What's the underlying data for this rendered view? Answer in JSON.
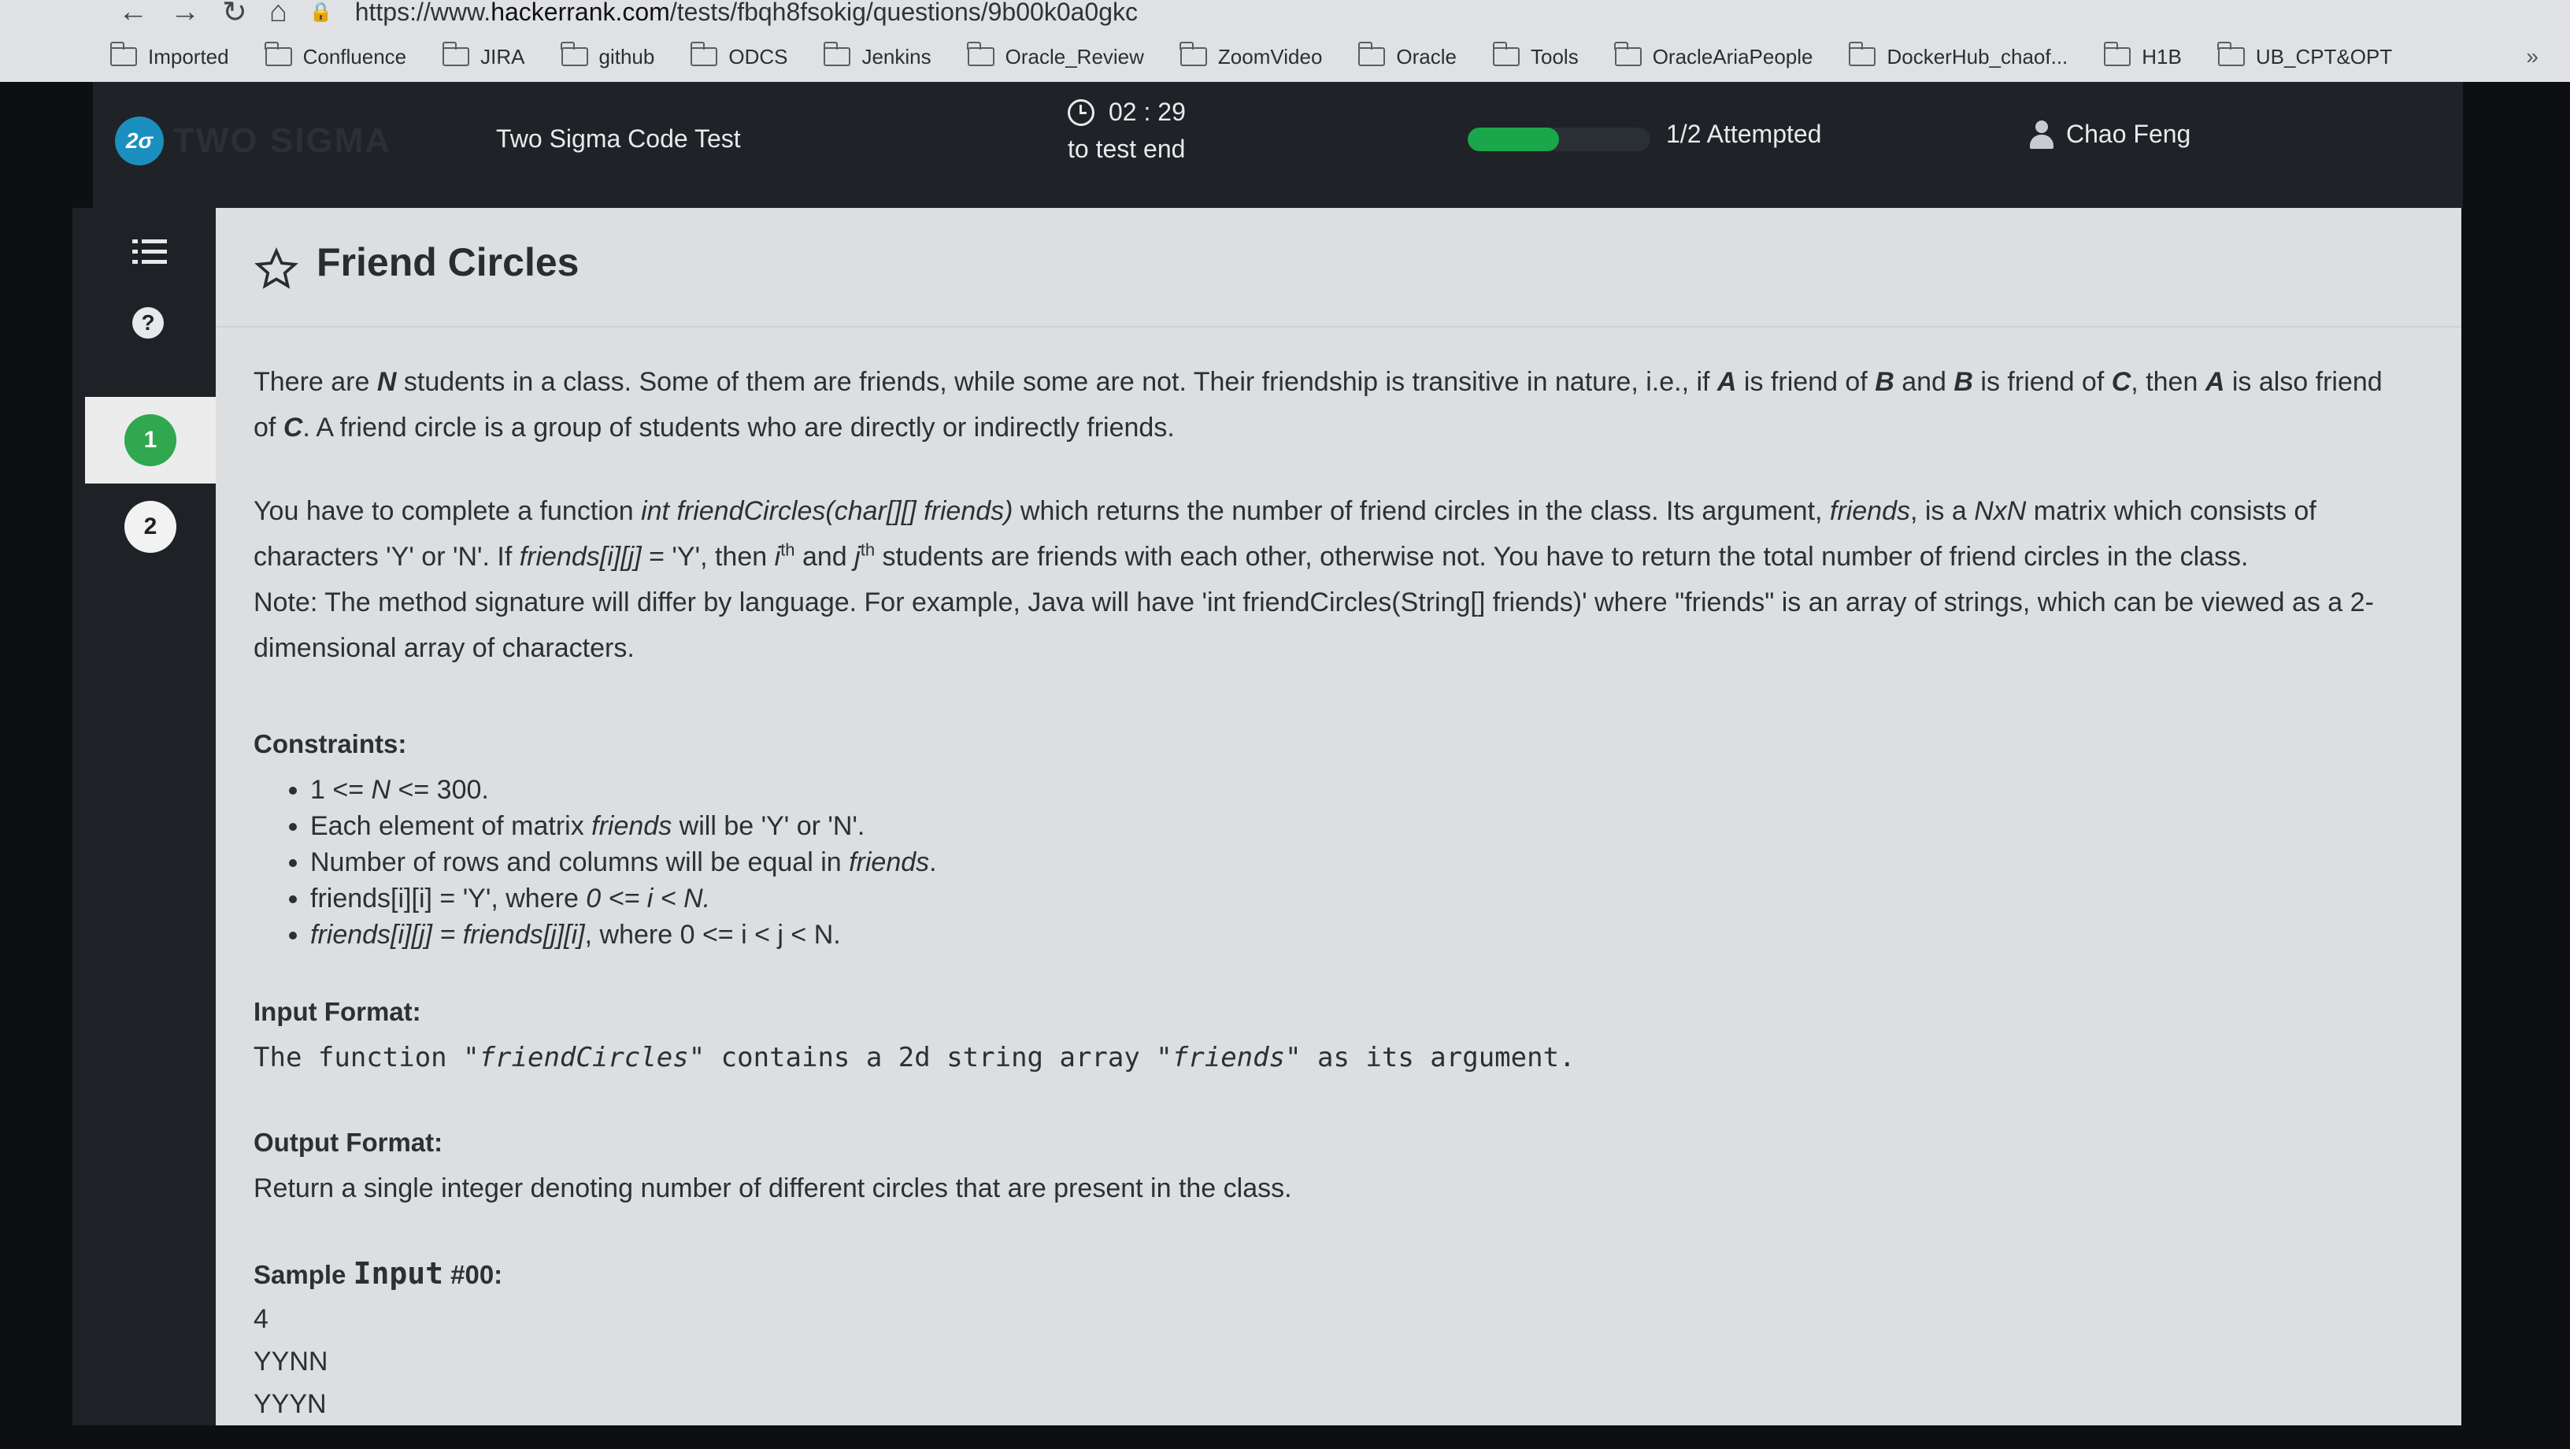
{
  "browser": {
    "url_prefix": "https://www.",
    "url_domain": "hackerrank.com",
    "url_path": "/tests/fbqh8fsokig/questions/9b00k0a0gkc",
    "bookmarks": [
      "Imported",
      "Confluence",
      "JIRA",
      "github",
      "ODCS",
      "Jenkins",
      "Oracle_Review",
      "ZoomVideo",
      "Oracle",
      "Tools",
      "OracleAriaPeople",
      "DockerHub_chaof...",
      "H1B",
      "UB_CPT&OPT"
    ],
    "more": "»"
  },
  "header": {
    "logo_text": "TWO SIGMA",
    "logo_badge": "2σ",
    "test_title": "Two Sigma Code Test",
    "timer": "02 : 29",
    "timer_sub": "to test end",
    "progress_fraction": 0.5,
    "attempted": "1/2 Attempted",
    "user": "Chao Feng",
    "accent": "#1aa64a"
  },
  "sidebar": {
    "questions": [
      "1",
      "2"
    ],
    "active_question": "1",
    "icons": [
      "list-icon",
      "help-icon"
    ]
  },
  "problem": {
    "title": "Friend Circles",
    "p1_a": "There are ",
    "p1_n": "N",
    "p1_b": " students in a class. Some of them are friends, while some are not. Their friendship is transitive in nature, i.e., if ",
    "p1_A": "A",
    "p1_c": " is friend of ",
    "p1_B": "B",
    "p1_d": " and ",
    "p1_B2": "B",
    "p1_e": " is friend of ",
    "p1_C": "C",
    "p1_f": ", then ",
    "p1_A2": "A",
    "p1_g": " is also friend of ",
    "p1_C2": "C",
    "p1_h": ". A friend circle is a group of students who are directly or indirectly friends.",
    "p2_a": "You have to complete a function ",
    "p2_sig": "int friendCircles(char[][] friends)",
    "p2_b": " which returns the number of friend circles in the class. Its argument, ",
    "p2_friends": "friends",
    "p2_c": ", is a ",
    "p2_nxn": "NxN",
    "p2_d": " matrix which consists of characters 'Y' or 'N'.  If ",
    "p2_cond": "friends[i][j]",
    "p2_e": " = 'Y', then ",
    "p2_i": "i",
    "p2_th": "th",
    "p2_f": " and ",
    "p2_j": "j",
    "p2_th2": "th",
    "p2_g": " students are friends with each other, otherwise not. You have to return the total number of friend circles in the class.",
    "note": "Note: The method signature will differ by language. For example, Java will have 'int friendCircles(String[] friends)' where \"friends\" is an array of strings, which can be viewed as a 2-dimensional array of characters.",
    "constraints_title": "Constraints:",
    "constraints": [
      {
        "pre": "1 <= ",
        "it": "N",
        "post": " <= 300."
      },
      {
        "pre": "Each element of matrix ",
        "it": "friends",
        "post": " will be 'Y' or 'N'."
      },
      {
        "pre": "Number of rows and columns will be equal in ",
        "it": "friends",
        "post": "."
      },
      {
        "pre": "friends[i][i] = 'Y', where ",
        "it": "0 <= i < N.",
        "post": ""
      },
      {
        "pre": "",
        "it": "friends[i][j] = friends[j][i]",
        "post": ", where 0 <= i < j < N."
      }
    ],
    "input_title": "Input Format:",
    "input_a": "The function \"",
    "input_fn": "friendCircles",
    "input_b": "\" contains a 2d string array \"",
    "input_arg": "friends",
    "input_c": "\" as its argument.",
    "output_title": "Output Format:",
    "output_text": "Return a single integer denoting number of different circles that are present in the class.",
    "sample_title_a": "Sample ",
    "sample_title_b": "Input",
    "sample_title_c": " #00:",
    "sample_lines": [
      "4",
      "YYNN",
      "YYYN"
    ]
  }
}
